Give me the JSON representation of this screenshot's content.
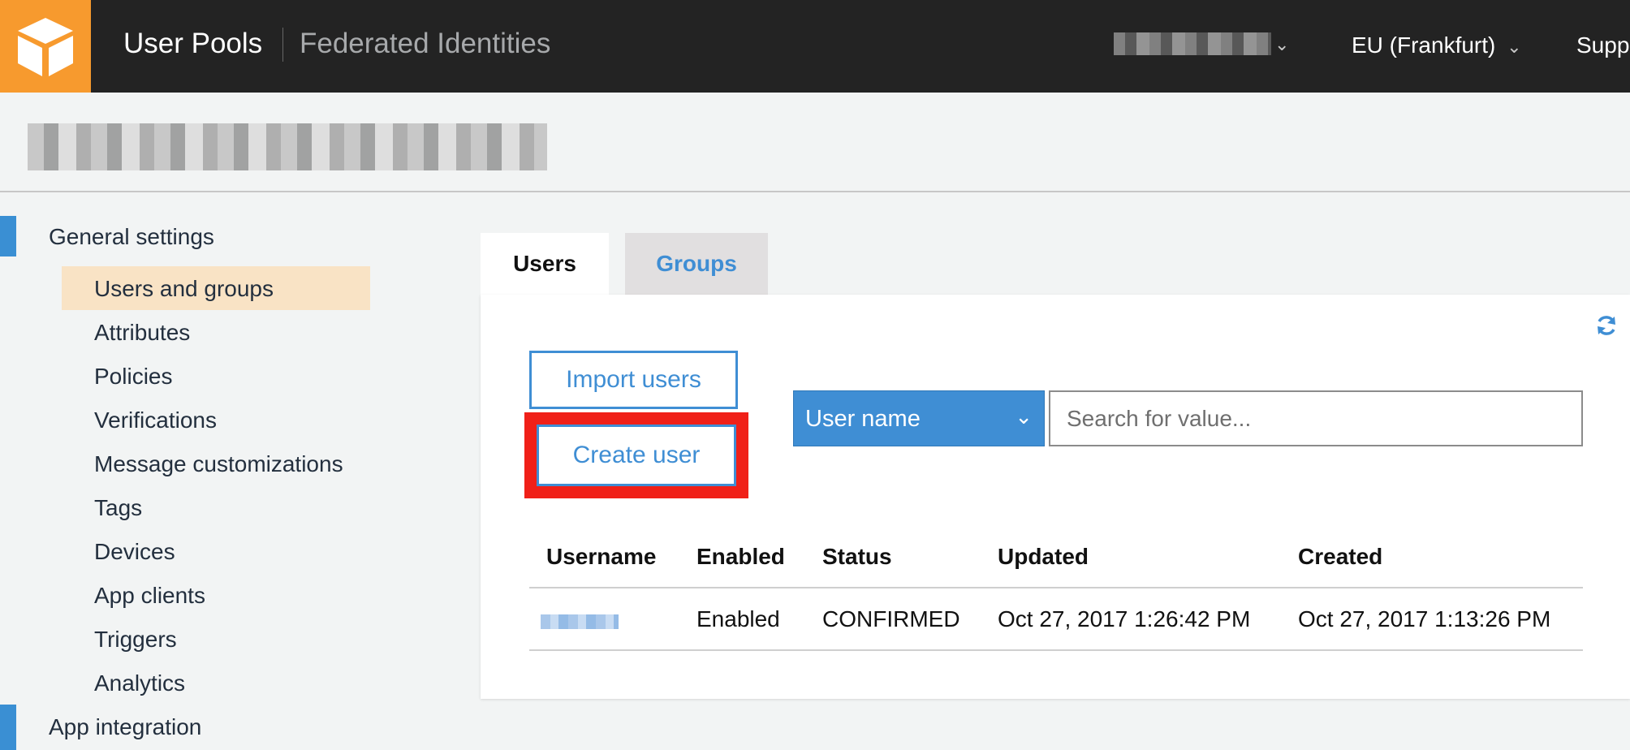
{
  "topbar": {
    "primary": "User Pools",
    "secondary": "Federated Identities",
    "region": "EU (Frankfurt)",
    "support": "Supp"
  },
  "sidebar": {
    "sections": [
      {
        "label": "General settings",
        "items": [
          "Users and groups",
          "Attributes",
          "Policies",
          "Verifications",
          "Message customizations",
          "Tags",
          "Devices",
          "App clients",
          "Triggers",
          "Analytics"
        ]
      },
      {
        "label": "App integration"
      }
    ],
    "active_item": "Users and groups"
  },
  "tabs": [
    {
      "label": "Users",
      "active": true
    },
    {
      "label": "Groups",
      "active": false
    }
  ],
  "actions": {
    "import_label": "Import users",
    "create_label": "Create user"
  },
  "search": {
    "field": "User name",
    "placeholder": "Search for value..."
  },
  "table": {
    "headers": [
      "Username",
      "Enabled",
      "Status",
      "Updated",
      "Created"
    ],
    "rows": [
      {
        "username": "",
        "enabled": "Enabled",
        "status": "CONFIRMED",
        "updated": "Oct 27, 2017 1:26:42 PM",
        "created": "Oct 27, 2017 1:13:26 PM"
      }
    ]
  },
  "colors": {
    "accent": "#3f8ed4",
    "logo": "#f79a2e",
    "highlight": "#f02018",
    "active_bg": "#f9e3c5"
  }
}
